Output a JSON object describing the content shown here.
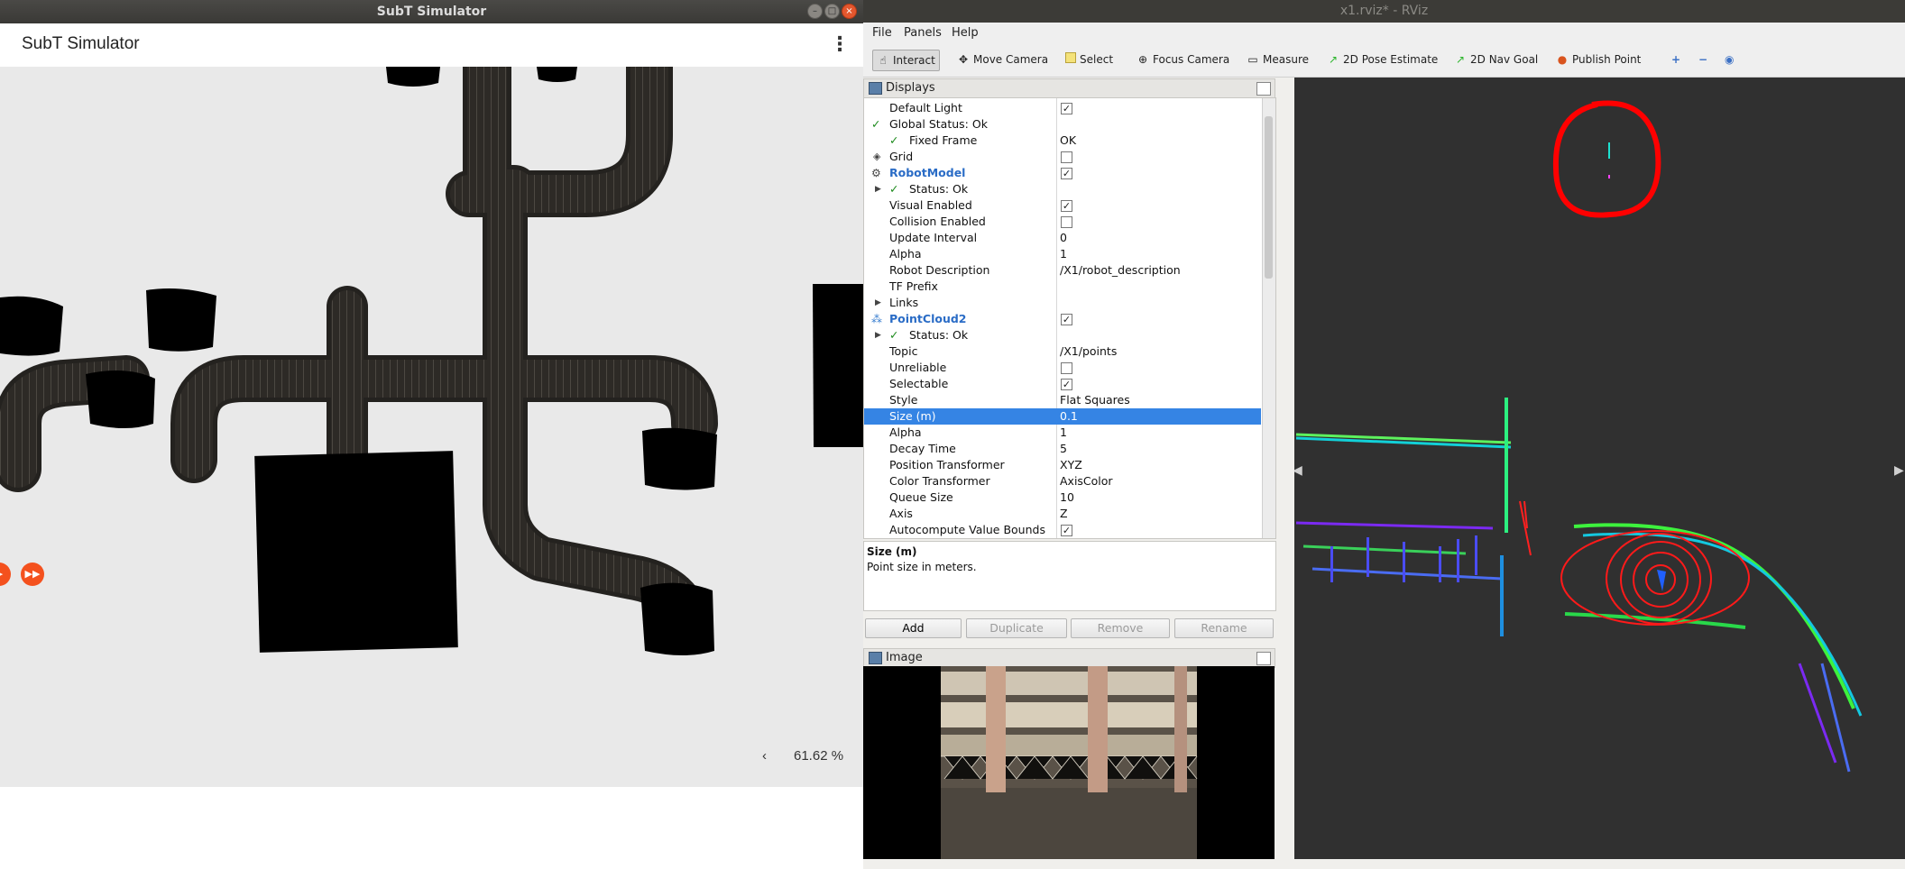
{
  "subt": {
    "window_title": "SubT Simulator",
    "app_title": "SubT Simulator",
    "zoom_level": "61.62 %",
    "zoom_prev": "‹",
    "menu_icon": "more-vert-icon",
    "controls": {
      "play_icon": "play-icon",
      "fast_forward_icon": "fast-forward-icon"
    }
  },
  "rviz": {
    "window_title": "x1.rviz* - RViz",
    "menu": [
      "File",
      "Panels",
      "Help"
    ],
    "toolbar": {
      "interact": "Interact",
      "move_camera": "Move Camera",
      "select": "Select",
      "focus_camera": "Focus Camera",
      "measure": "Measure",
      "pose_estimate": "2D Pose Estimate",
      "nav_goal": "2D Nav Goal",
      "publish_point": "Publish Point"
    },
    "displays": {
      "title": "Displays",
      "rows": {
        "default_light": "Default Light",
        "global_status": "Global Status: Ok",
        "fixed_frame": "Fixed Frame",
        "fixed_frame_value": "OK",
        "grid": "Grid",
        "robot_model": "RobotModel",
        "rm_status": "Status: Ok",
        "visual_enabled": "Visual Enabled",
        "collision_enabled": "Collision Enabled",
        "update_interval": "Update Interval",
        "update_interval_value": "0",
        "alpha": "Alpha",
        "alpha_value": "1",
        "robot_description": "Robot Description",
        "robot_description_value": "/X1/robot_description",
        "tf_prefix": "TF Prefix",
        "links": "Links",
        "point_cloud": "PointCloud2",
        "pc_status": "Status: Ok",
        "topic": "Topic",
        "topic_value": "/X1/points",
        "unreliable": "Unreliable",
        "selectable": "Selectable",
        "style": "Style",
        "style_value": "Flat Squares",
        "size": "Size (m)",
        "size_value": "0.1",
        "alpha2": "Alpha",
        "alpha2_value": "1",
        "decay_time": "Decay Time",
        "decay_time_value": "5",
        "position_transformer": "Position Transformer",
        "position_transformer_value": "XYZ",
        "color_transformer": "Color Transformer",
        "color_transformer_value": "AxisColor",
        "queue_size": "Queue Size",
        "queue_size_value": "10",
        "axis": "Axis",
        "axis_value": "Z",
        "autocompute": "Autocompute Value Bounds"
      }
    },
    "description": {
      "title": "Size (m)",
      "text": "Point size in meters."
    },
    "buttons": {
      "add": "Add",
      "duplicate": "Duplicate",
      "remove": "Remove",
      "rename": "Rename"
    },
    "image_panel": {
      "title": "Image"
    }
  },
  "colors": {
    "selection": "#3584e4",
    "accent_orange": "#f4511e",
    "rviz_bg": "#303030",
    "annotation_red": "#ff0000"
  }
}
